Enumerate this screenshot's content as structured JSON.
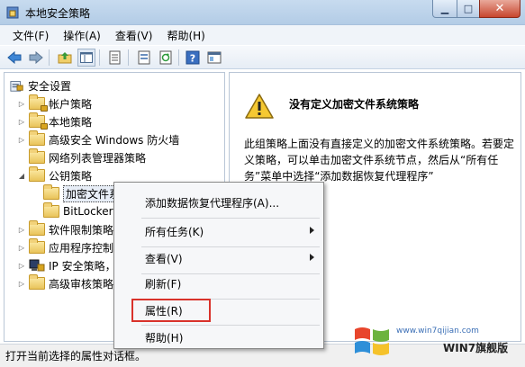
{
  "window": {
    "title": "本地安全策略"
  },
  "menubar": {
    "items": [
      "文件(F)",
      "操作(A)",
      "查看(V)",
      "帮助(H)"
    ]
  },
  "toolbar": {
    "icons": [
      "back-arrow-icon",
      "forward-arrow-icon",
      "up-folder-icon",
      "show-tree-icon",
      "copy-icon",
      "export-icon",
      "refresh-icon",
      "help-icon",
      "properties-icon"
    ]
  },
  "tree": {
    "root": "安全设置",
    "items": [
      {
        "label": "帐户策略",
        "level": 1,
        "expand": "collapsed",
        "icon": "folder-lock"
      },
      {
        "label": "本地策略",
        "level": 1,
        "expand": "collapsed",
        "icon": "folder-lock"
      },
      {
        "label": "高级安全 Windows 防火墙",
        "level": 1,
        "expand": "collapsed",
        "icon": "folder"
      },
      {
        "label": "网络列表管理器策略",
        "level": 1,
        "expand": "none",
        "icon": "folder"
      },
      {
        "label": "公钥策略",
        "level": 1,
        "expand": "expanded",
        "icon": "folder"
      },
      {
        "label": "加密文件系统",
        "level": 2,
        "expand": "none",
        "icon": "folder",
        "selected": true
      },
      {
        "label": "BitLocker",
        "level": 2,
        "expand": "none",
        "icon": "folder"
      },
      {
        "label": "软件限制策略",
        "level": 1,
        "expand": "collapsed",
        "icon": "folder"
      },
      {
        "label": "应用程序控制",
        "level": 1,
        "expand": "collapsed",
        "icon": "folder"
      },
      {
        "label": "IP 安全策略，",
        "level": 1,
        "expand": "collapsed",
        "icon": "ipsec"
      },
      {
        "label": "高级审核策略",
        "level": 1,
        "expand": "collapsed",
        "icon": "folder"
      }
    ]
  },
  "content": {
    "heading": "没有定义加密文件系统策略",
    "description": "此组策略上面没有直接定义的加密文件系统策略。若要定义策略，可以单击加密文件系统节点，然后从“所有任务”菜单中选择“添加数据恢复代理程序”"
  },
  "context_menu": {
    "items": [
      {
        "label": "添加数据恢复代理程序(A)...",
        "submenu": false
      },
      {
        "label": "所有任务(K)",
        "submenu": true
      },
      {
        "label": "查看(V)",
        "submenu": true
      },
      {
        "label": "刷新(F)",
        "submenu": false
      },
      {
        "label": "属性(R)",
        "submenu": false,
        "highlighted": true
      },
      {
        "label": "帮助(H)",
        "submenu": false
      }
    ]
  },
  "statusbar": {
    "text": "打开当前选择的属性对话框。"
  },
  "watermark": {
    "site": "www.win7qijian.com",
    "brand": "WIN7旗舰版"
  },
  "colors": {
    "highlight_border": "#d9322b",
    "titlebar": "#c7dbef",
    "folder": "#e9c35a"
  }
}
